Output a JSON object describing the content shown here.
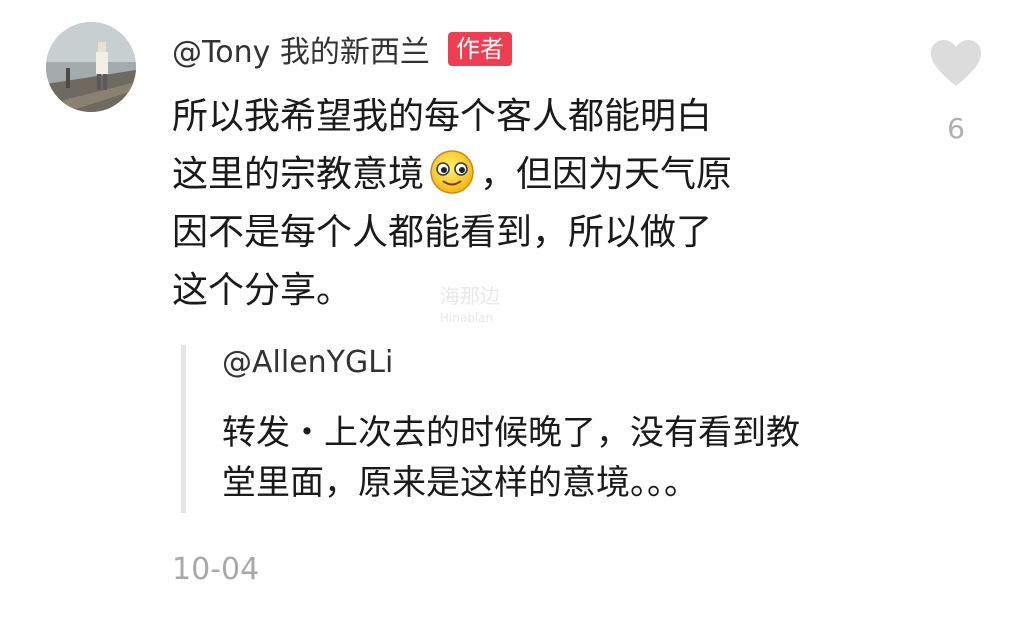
{
  "comment": {
    "username": "@Tony 我的新西兰",
    "badge": "作者",
    "lines": [
      "所以我希望我的每个客人都能明白",
      "这里的宗教意境",
      "，但因为天气原",
      "因不是每个人都能看到，所以做了",
      "这个分享。"
    ],
    "emoji": "smiling-face-emoji",
    "date": "10-04"
  },
  "like": {
    "count": "6",
    "icon": "heart-icon"
  },
  "quote": {
    "username": "@AllenYGLi",
    "lines": [
      "转发・上次去的时候晚了，没有看到教",
      "堂里面，原来是这样的意境。。。"
    ]
  },
  "watermark": {
    "text": "海那边",
    "sub": "Hinabian"
  },
  "colors": {
    "badge": "#ee3f52",
    "muted": "#a9a9a9",
    "quote_bar": "#e6e6e6"
  }
}
